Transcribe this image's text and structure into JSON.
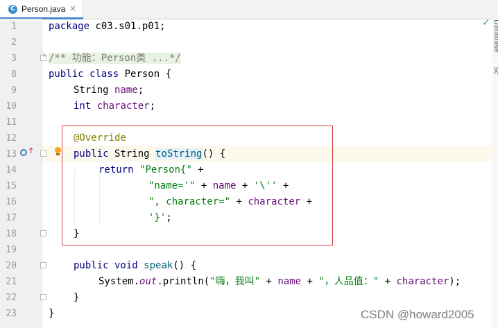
{
  "tab": {
    "icon": "C",
    "label": "Person.java",
    "close": "×"
  },
  "status": {
    "check": "✓"
  },
  "side_panel": {
    "label_1": "Database",
    "label_2": "Sc"
  },
  "line_numbers": [
    "1",
    "2",
    "3",
    "8",
    "9",
    "10",
    "11",
    "12",
    "13",
    "14",
    "15",
    "16",
    "17",
    "18",
    "19",
    "20",
    "21",
    "22",
    "23"
  ],
  "code": {
    "l1_kw": "package",
    "l1_rest": " c03.s01.p01;",
    "l3_comment": "/** 功能：Person类 ...*/",
    "l8_kw": "public class",
    "l8_rest": " Person {",
    "l9_type": "String",
    "l9_field": "name",
    "l9_end": ";",
    "l10_kw": "int",
    "l10_field": "character",
    "l10_end": ";",
    "l12_ann": "@Override",
    "l13_kw": "public",
    "l13_type": " String ",
    "l13_method": "toString",
    "l13_end": "() {",
    "l14_kw": "return",
    "l14_str": "\"Person{\"",
    "l14_end": " +",
    "l15_str1": "\"name='\"",
    "l15_op1": " + ",
    "l15_field": "name",
    "l15_op2": " + ",
    "l15_str2": "'\\''",
    "l15_end": " +",
    "l16_str": "\", character=\"",
    "l16_op": " + ",
    "l16_field": "character",
    "l16_end": " +",
    "l17_str": "'}'",
    "l17_end": ";",
    "l18": "}",
    "l20_kw": "public void",
    "l20_method": "speak",
    "l20_end": "() {",
    "l21_a": "System.",
    "l21_out": "out",
    "l21_b": ".println(",
    "l21_str1": "\"嗨，我叫\"",
    "l21_op1": " + ",
    "l21_field1": "name",
    "l21_op2": " + ",
    "l21_str2": "\"，人品值：\"",
    "l21_op3": " + ",
    "l21_field2": "character",
    "l21_end": ");",
    "l22": "}",
    "l23": "}"
  },
  "watermark": "CSDN @howard2005",
  "colors": {
    "keyword": "#000080",
    "field": "#660e7a",
    "string": "#067d17",
    "annotation": "#808000",
    "highlight_box": "#d03a3a"
  }
}
